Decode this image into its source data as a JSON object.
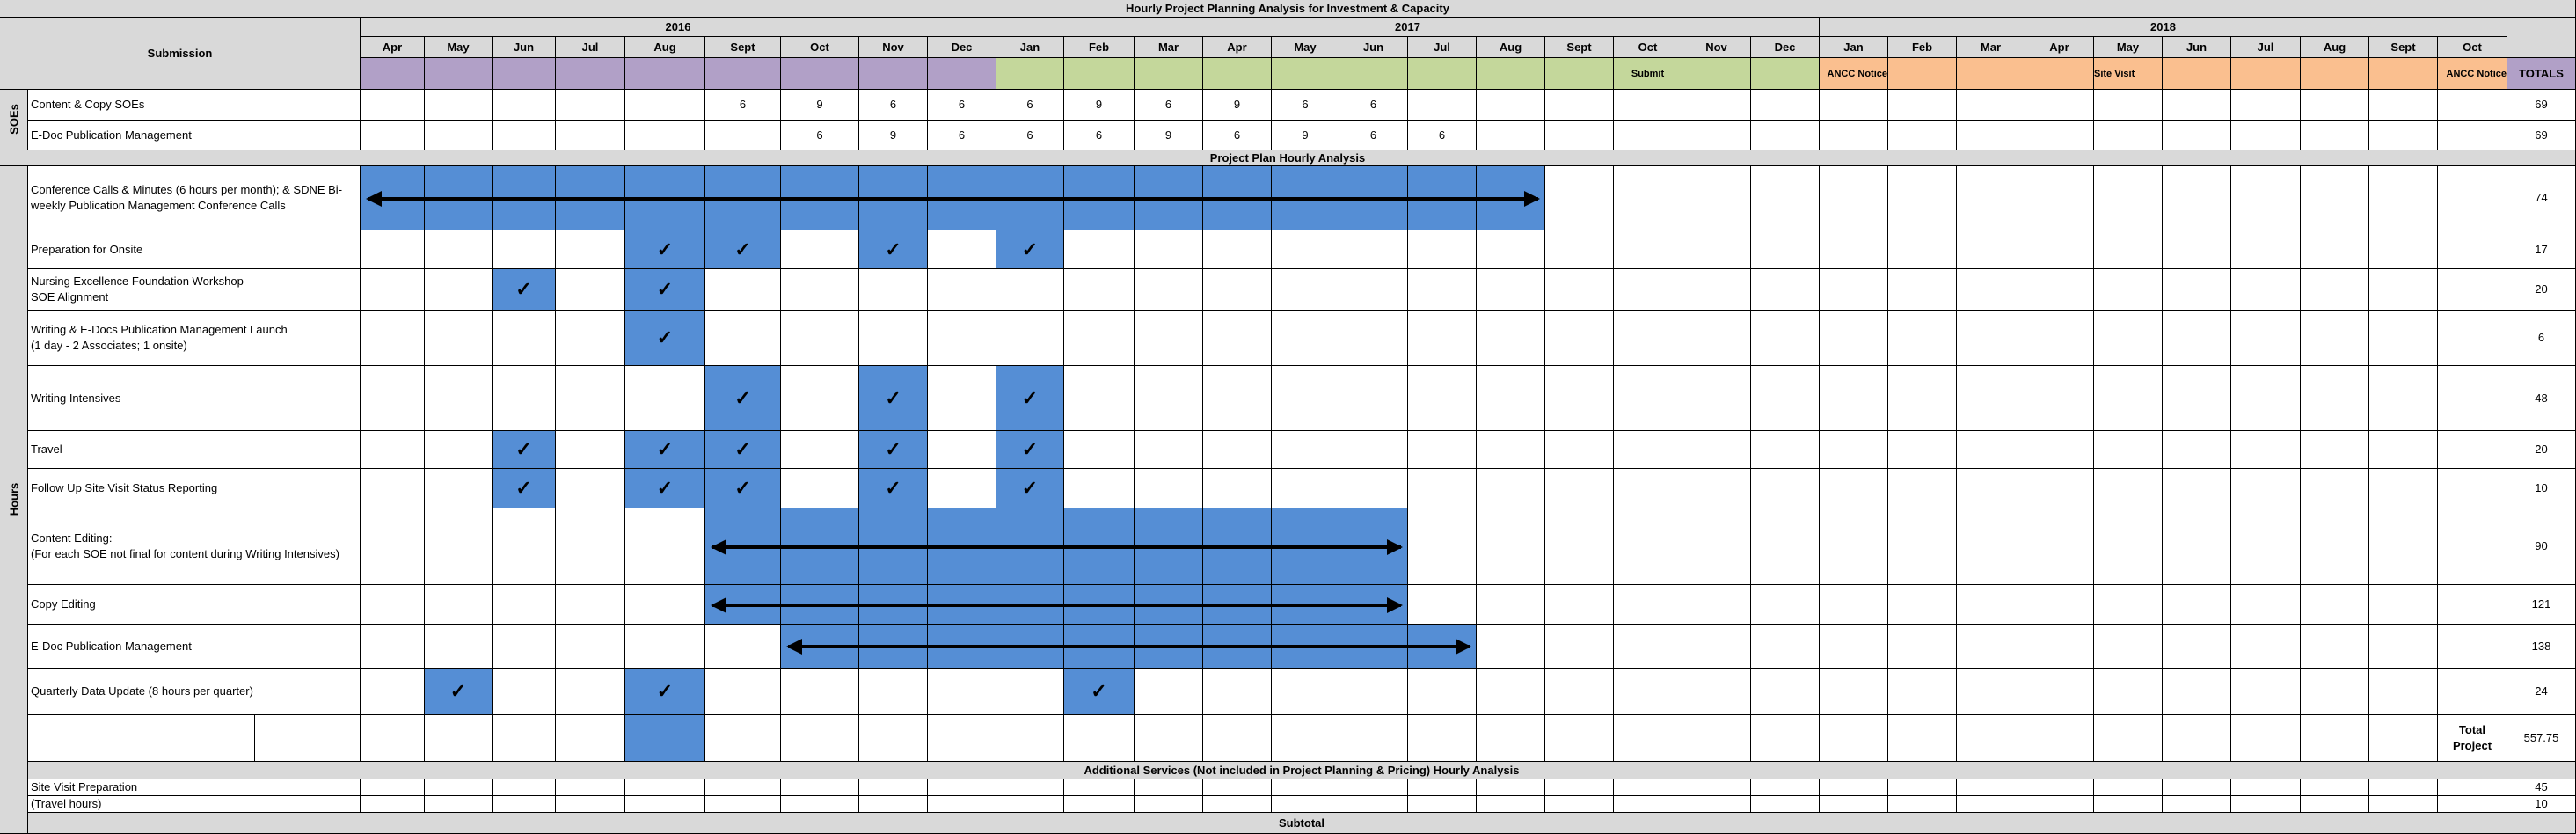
{
  "title": "Hourly Project Planning Analysis for Investment & Capacity",
  "submission_label": "Submission",
  "years": [
    "2016",
    "2017",
    "2018"
  ],
  "months": [
    "Apr",
    "May",
    "Jun",
    "Jul",
    "Aug",
    "Sept",
    "Oct",
    "Nov",
    "Dec",
    "Jan",
    "Feb",
    "Mar",
    "Apr",
    "May",
    "Jun",
    "Jul",
    "Aug",
    "Sept",
    "Oct",
    "Nov",
    "Dec",
    "Jan",
    "Feb",
    "Mar",
    "Apr",
    "May",
    "Jun",
    "Jul",
    "Aug",
    "Sept",
    "Oct"
  ],
  "phase_labels": {
    "submit": "Submit",
    "ancc_notice_1": "ANCC Notice",
    "site_visit": "Site Visit",
    "ancc_notice_2": "ANCC Notice",
    "totals": "TOTALS"
  },
  "soe_section_label": "SOEs",
  "hours_section_label": "Hours",
  "soe_rows": [
    {
      "label": "Content & Copy SOEs",
      "values": {
        "5": "6",
        "6": "9",
        "7": "6",
        "8": "6",
        "9": "6",
        "10": "9",
        "11": "6",
        "12": "9",
        "13": "6",
        "14": "6"
      },
      "total": "69"
    },
    {
      "label": "E-Doc Publication Management",
      "values": {
        "6": "6",
        "7": "9",
        "8": "6",
        "9": "6",
        "10": "6",
        "11": "9",
        "12": "6",
        "13": "9",
        "14": "6",
        "15": "6"
      },
      "total": "69"
    }
  ],
  "plan_section_title": "Project Plan Hourly Analysis",
  "hour_rows": [
    {
      "label": "Conference Calls & Minutes  (6 hours per month); & SDNE Bi-weekly Publication Management Conference Calls",
      "shaded_months": [
        0,
        16
      ],
      "checks": [],
      "arrow_months": [
        0,
        16
      ],
      "total": "74"
    },
    {
      "label": "Preparation for Onsite",
      "shaded_months": [],
      "checks": [
        4,
        5,
        7,
        9
      ],
      "total": "17"
    },
    {
      "label": "Nursing Excellence Foundation Workshop\nSOE Alignment",
      "shaded_months": [],
      "checks": [
        2,
        4
      ],
      "total": "20"
    },
    {
      "label": "Writing & E-Docs Publication Management Launch\n(1 day - 2 Associates; 1 onsite)",
      "shaded_months": [],
      "checks": [
        4
      ],
      "total": "6"
    },
    {
      "label": "Writing Intensives",
      "shaded_months": [],
      "checks": [
        5,
        7,
        9
      ],
      "total": "48"
    },
    {
      "label": "Travel",
      "shaded_months": [],
      "checks": [
        2,
        4,
        5,
        7,
        9
      ],
      "total": "20"
    },
    {
      "label": "Follow Up Site Visit Status Reporting",
      "shaded_months": [],
      "checks": [
        2,
        4,
        5,
        7,
        9
      ],
      "total": "10"
    },
    {
      "label": "Content Editing:\n(For each SOE not final for content during Writing Intensives)",
      "shaded_months": [
        5,
        14
      ],
      "checks": [],
      "arrow_months": [
        5,
        14
      ],
      "total": "90"
    },
    {
      "label": "Copy Editing",
      "shaded_months": [
        5,
        14
      ],
      "checks": [],
      "arrow_months": [
        5,
        14
      ],
      "total": "121"
    },
    {
      "label": "E-Doc Publication Management",
      "shaded_months": [
        6,
        15
      ],
      "checks": [],
      "arrow_months": [
        6,
        15
      ],
      "total": "138"
    },
    {
      "label": "Quarterly Data Update (8 hours per quarter)",
      "shaded_months": [],
      "checks": [
        1,
        4,
        10
      ],
      "total": "24"
    },
    {
      "label": "",
      "shaded_months": [],
      "checks": [],
      "blank_shaded": [
        4
      ],
      "total": "557.75"
    }
  ],
  "total_project_label": "Total\nProject",
  "additional_section_title": "Additional Services (Not included in Project Planning & Pricing) Hourly Analysis",
  "additional_rows": [
    {
      "label": "Site Visit Preparation",
      "total": "45"
    },
    {
      "label": "(Travel hours)",
      "total": "10"
    }
  ],
  "subtotal_label": "Subtotal",
  "check_glyph": "✓",
  "colors": {
    "gray": "#d9d9d9",
    "purple": "#b1a0c7",
    "green": "#c4d79b",
    "orange": "#fabf8f",
    "blue": "#558ed5"
  }
}
